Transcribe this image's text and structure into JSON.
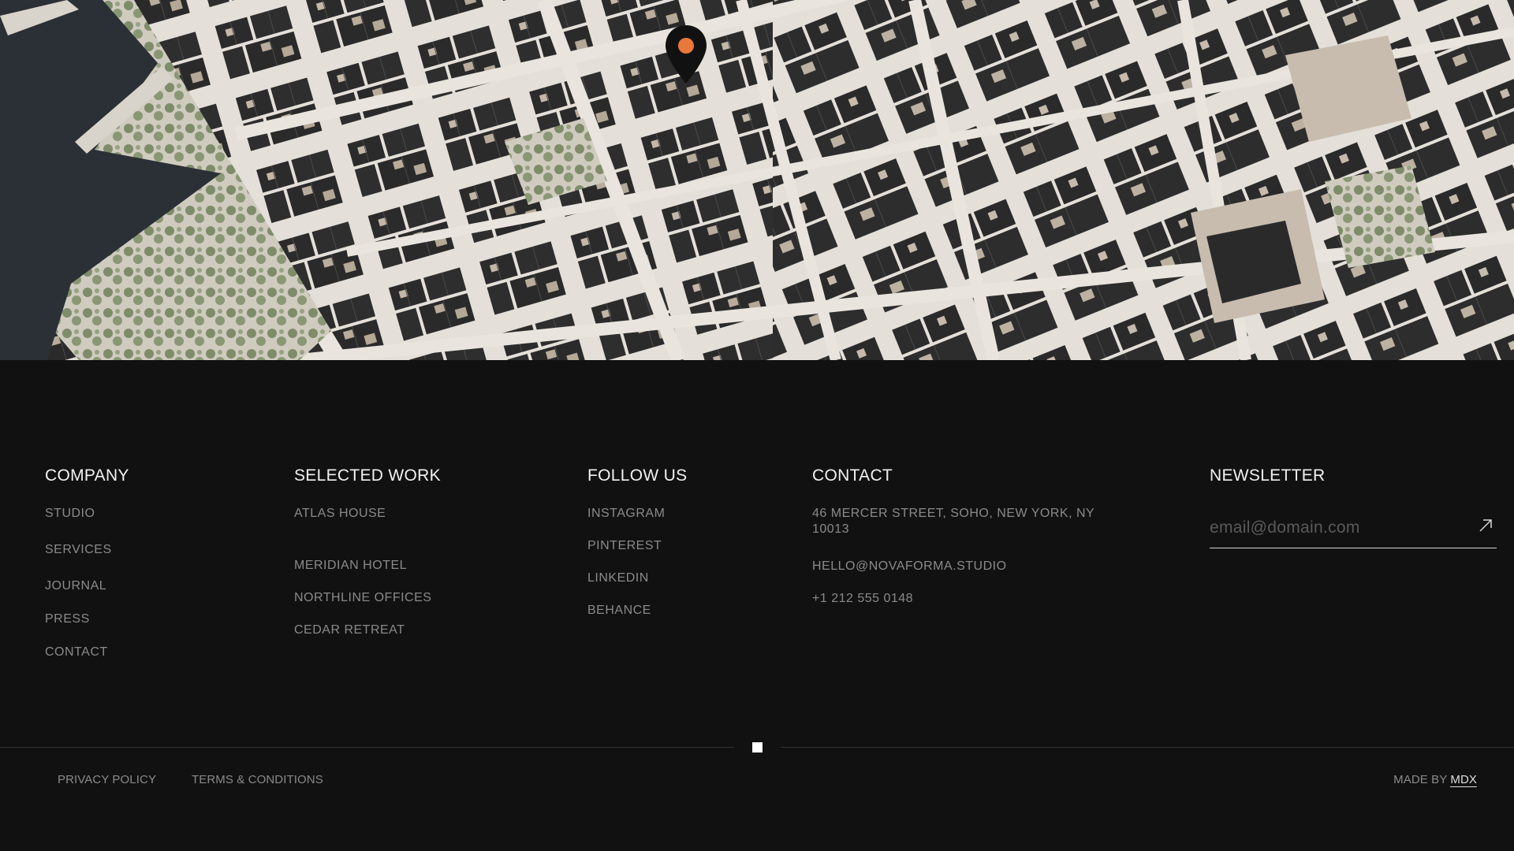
{
  "map": {
    "pin_label": "Studio location"
  },
  "footer": {
    "company": {
      "title": "COMPANY",
      "links": [
        "STUDIO",
        "SERVICES",
        "JOURNAL",
        "PRESS",
        "CONTACT"
      ]
    },
    "work": {
      "title": "SELECTED WORK",
      "links": [
        "ATLAS HOUSE",
        "MERIDIAN HOTEL",
        "NORTHLINE OFFICES",
        "CEDAR RETREAT"
      ]
    },
    "follow": {
      "title": "FOLLOW US",
      "links": [
        "INSTAGRAM",
        "PINTEREST",
        "LINKEDIN",
        "BEHANCE"
      ]
    },
    "contact": {
      "title": "CONTACT",
      "address": "46 MERCER STREET, SOHO, NEW YORK, NY 10013",
      "email": "HELLO@NOVAFORMA.STUDIO",
      "phone": "+1 212 555 0148"
    },
    "newsletter": {
      "title": "NEWSLETTER",
      "placeholder": "email@domain.com",
      "value": ""
    },
    "legal": {
      "privacy": "PRIVACY POLICY",
      "terms": "TERMS & CONDITIONS"
    },
    "credit": {
      "prefix": "MADE BY",
      "link": "MDX"
    }
  },
  "colors": {
    "background": "#111111",
    "heading": "#f2f2f2",
    "link": "#8a8a8a",
    "pin_body": "#111111",
    "pin_dot": "#e8793a",
    "water": "#2a3035",
    "building": "#2b2b2b",
    "street": "#e4e0d9",
    "park": "#8e9a78"
  },
  "icons": {
    "pin": "map-pin-icon",
    "submit": "arrow-up-right-icon"
  }
}
